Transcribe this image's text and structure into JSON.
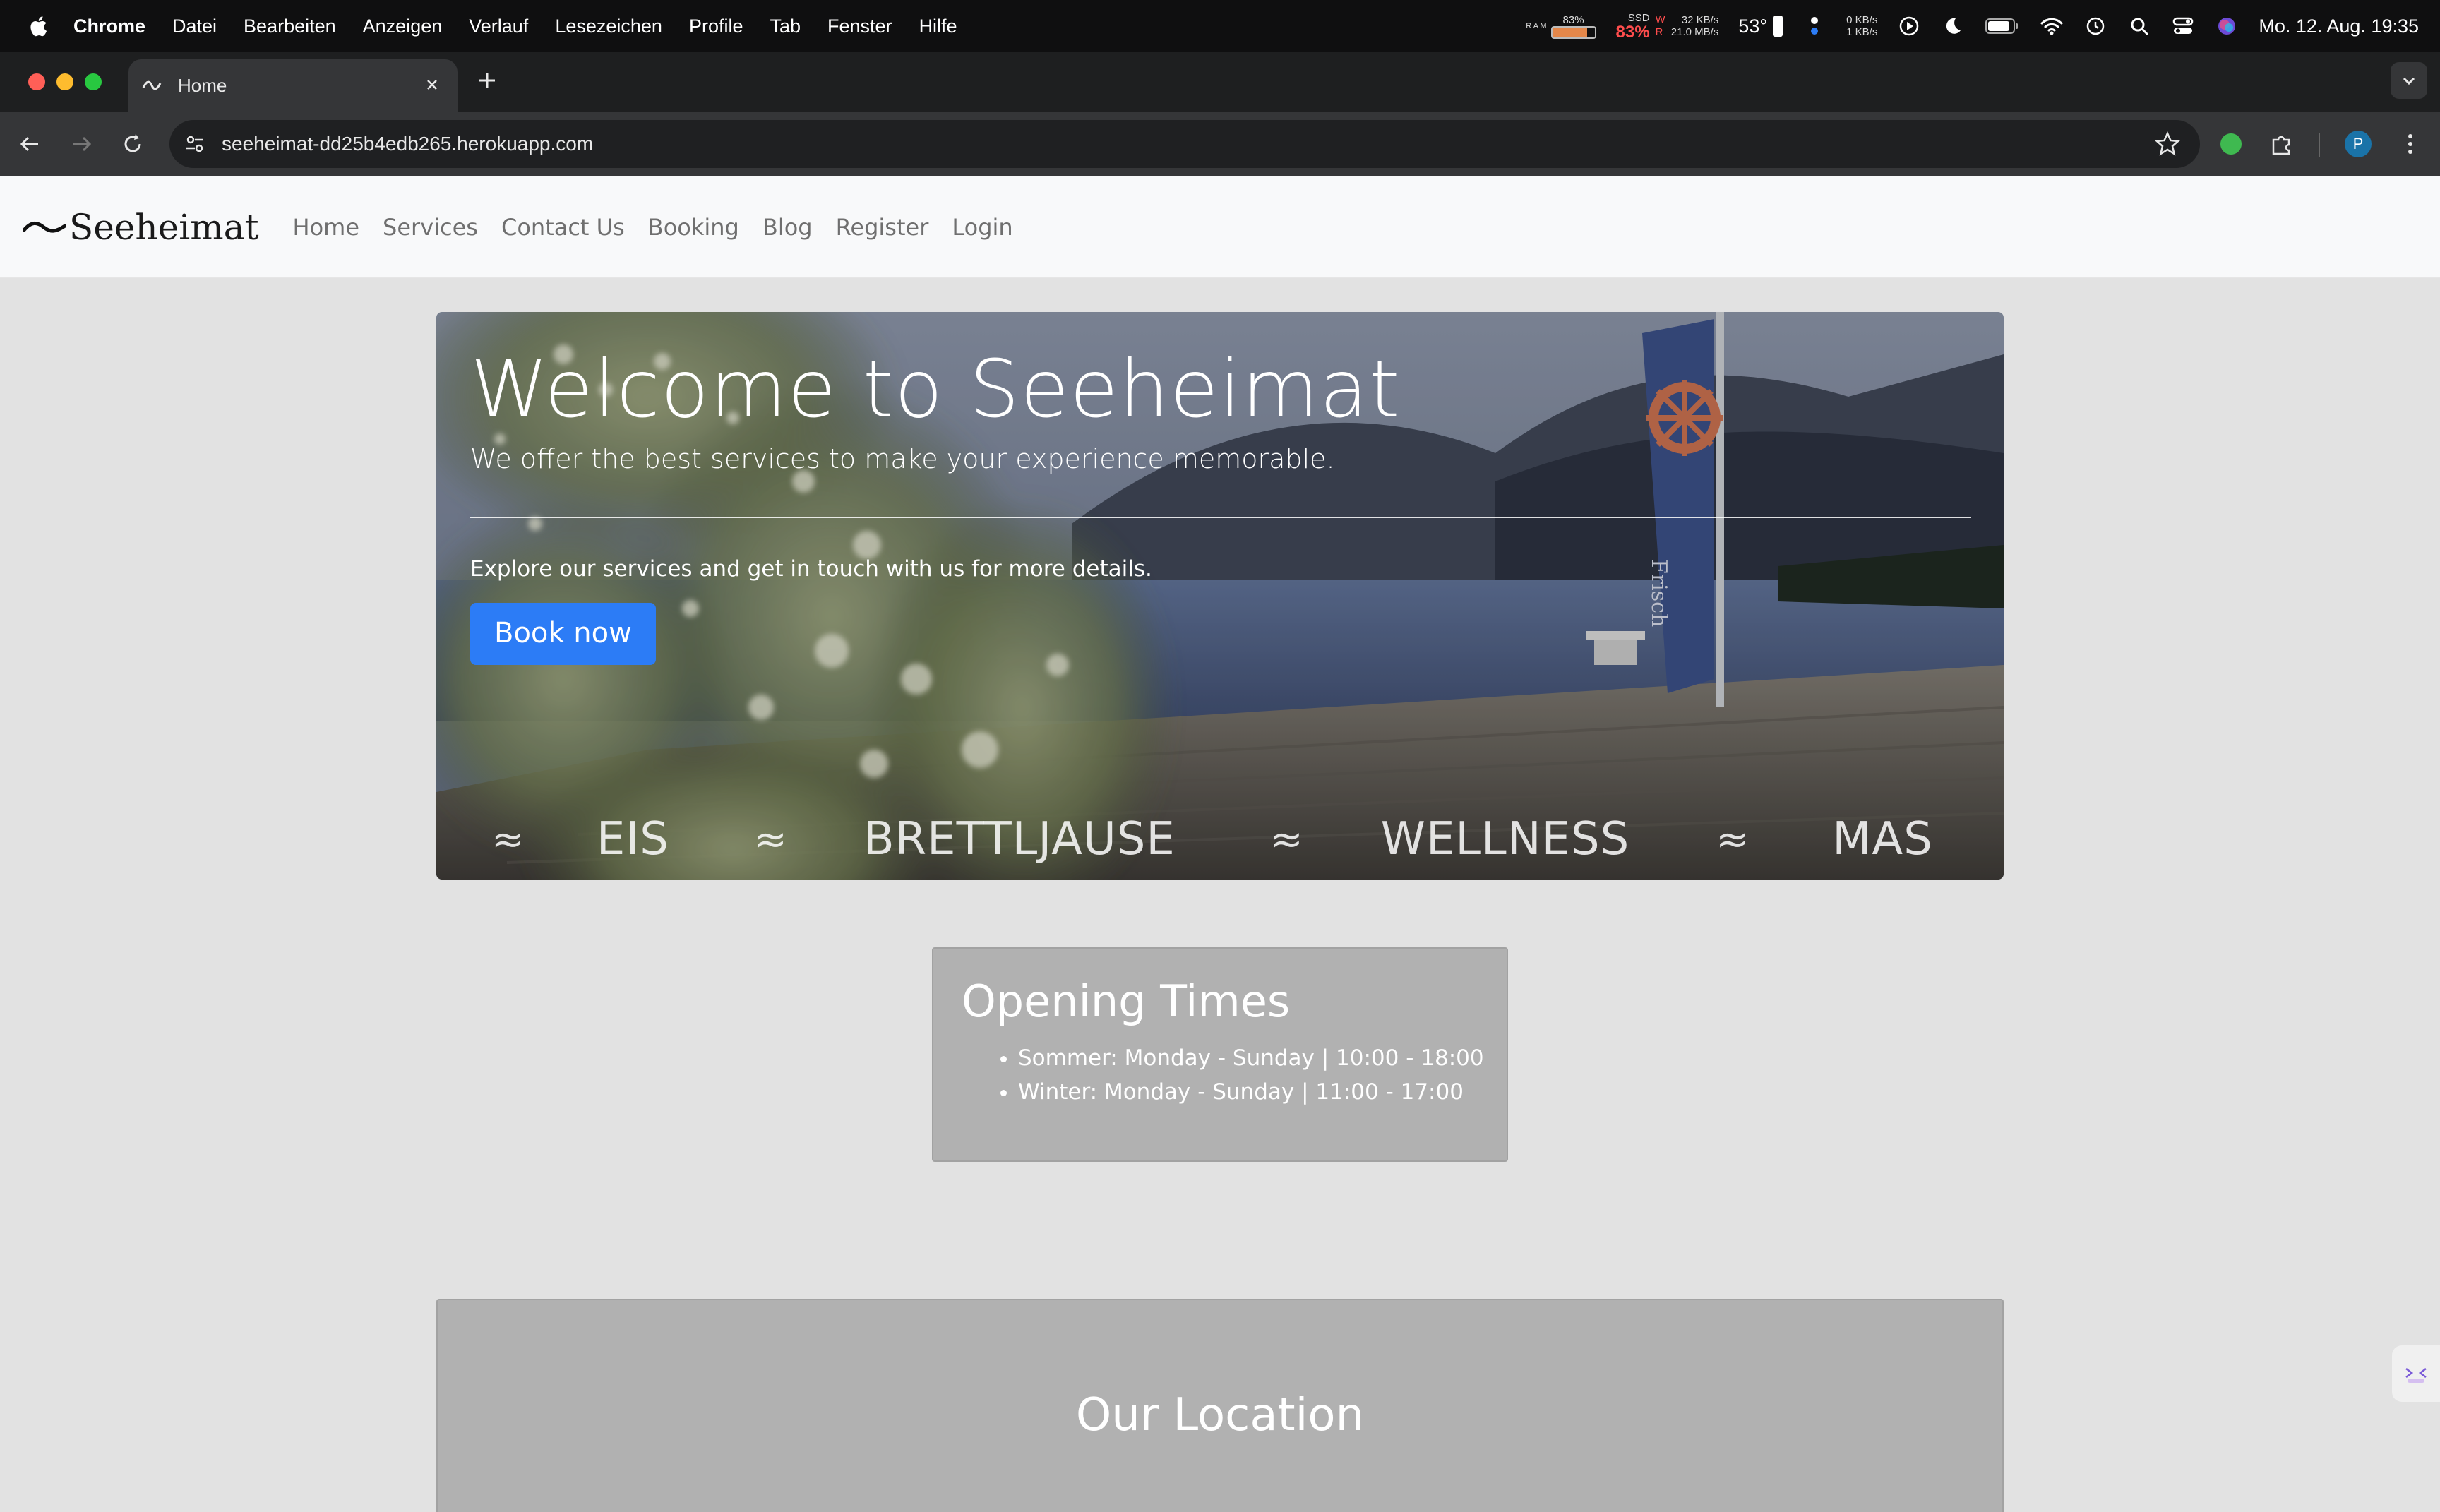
{
  "menubar": {
    "app_name": "Chrome",
    "menu_items": [
      "Datei",
      "Bearbeiten",
      "Anzeigen",
      "Verlauf",
      "Lesezeichen",
      "Profile",
      "Tab",
      "Fenster",
      "Hilfe"
    ],
    "ram_label": "R A M",
    "ram_percent_text": "83%",
    "ram_usage": 0.83,
    "ssd_label": "SSD",
    "ssd_percent": "83%",
    "disk_write": "32 KB/s",
    "disk_read": "21.0 MB/s",
    "disk_w_label": "W",
    "disk_r_label": "R",
    "temperature": "53°",
    "net_up": "0 KB/s",
    "net_down": "1 KB/s",
    "datetime": "Mo. 12. Aug.  19:35"
  },
  "browser": {
    "tab_title": "Home",
    "url": "seeheimat-dd25b4edb265.herokuapp.com",
    "profile_initial": "P"
  },
  "site": {
    "brand": "Seeheimat",
    "nav": [
      "Home",
      "Services",
      "Contact Us",
      "Booking",
      "Blog",
      "Register",
      "Login"
    ],
    "hero": {
      "title": "Welcome to Seeheimat",
      "lead": "We offer the best services to make your experience memorable.",
      "text": "Explore our services and get in touch with us for more details.",
      "button": "Book now",
      "ticker_separator": "≈",
      "ticker": [
        "EIS",
        "BRETTLJAUSE",
        "WELLNESS",
        "MAS"
      ]
    },
    "opening": {
      "title": "Opening Times",
      "items": [
        "Sommer: Monday - Sunday | 10:00 - 18:00",
        "Winter: Monday - Sunday | 11:00 - 17:00"
      ]
    },
    "location": {
      "title": "Our Location"
    }
  },
  "colors": {
    "accent_button": "#2c7cf6",
    "page_bg": "#e2e2e2",
    "card_bg": "#b1b1b1"
  }
}
